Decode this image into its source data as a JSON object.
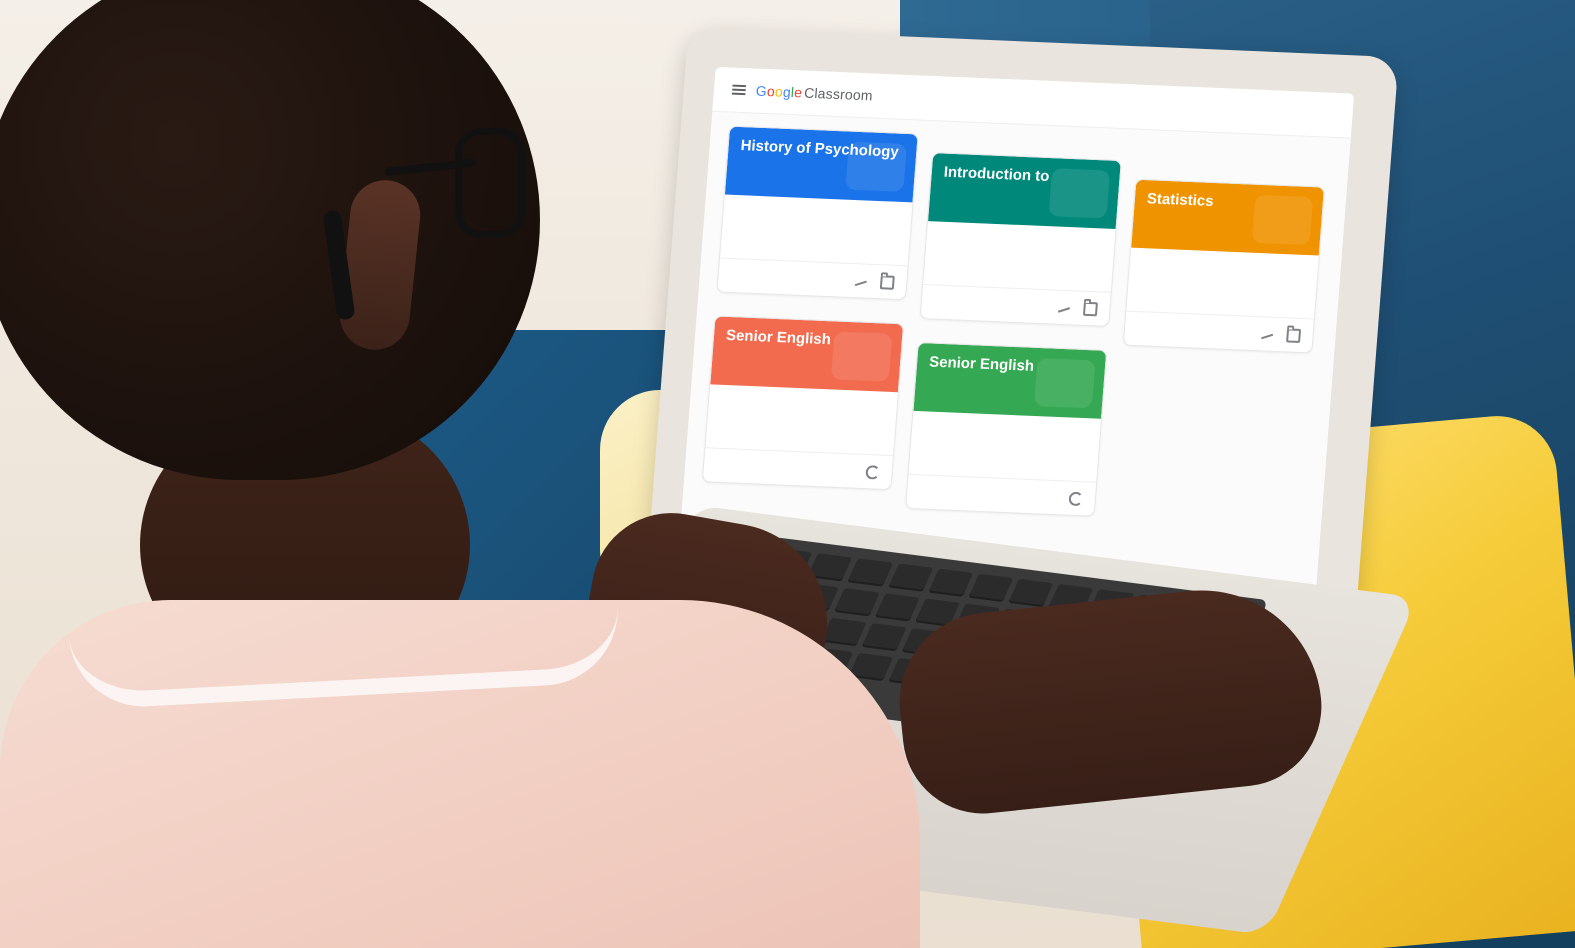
{
  "screen_ui": {
    "brand": {
      "google_letters": [
        "G",
        "o",
        "o",
        "g",
        "l",
        "e"
      ],
      "product": "Classroom"
    },
    "cards": [
      {
        "title": "History of Psychology",
        "subtitle": "",
        "header_color": "#1a73e8",
        "teacher_label": "",
        "teacher_name": "",
        "footer_icons": [
          "stats-icon",
          "folder-icon"
        ]
      },
      {
        "title": "Introduction to",
        "subtitle": "",
        "header_color": "#00897b",
        "teacher_label": "",
        "teacher_name": "",
        "footer_icons": [
          "stats-icon",
          "folder-icon"
        ]
      },
      {
        "title": "Statistics",
        "subtitle": "",
        "header_color": "#f09300",
        "teacher_label": "",
        "teacher_name": "",
        "footer_icons": [
          "stats-icon",
          "folder-icon"
        ]
      },
      {
        "title": "Senior English",
        "subtitle": "",
        "header_color": "#f26b4f",
        "teacher_label": "",
        "teacher_name": "",
        "footer_icons": [
          "refresh-icon"
        ]
      },
      {
        "title": "Senior English",
        "subtitle": "",
        "header_color": "#34a853",
        "teacher_label": "",
        "teacher_name": "",
        "footer_icons": [
          "refresh-icon"
        ]
      }
    ]
  }
}
